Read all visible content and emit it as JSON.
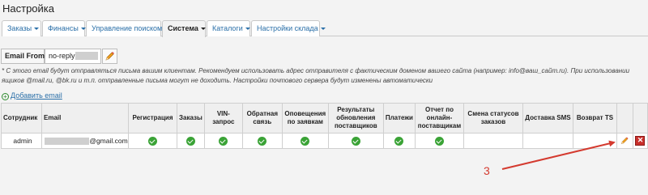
{
  "page": {
    "title": "Настройка"
  },
  "tabs": [
    {
      "label": "Заказы",
      "active": false
    },
    {
      "label": "Финансы",
      "active": false
    },
    {
      "label": "Управление поиском",
      "active": false
    },
    {
      "label": "Система",
      "active": true
    },
    {
      "label": "Каталоги",
      "active": false
    },
    {
      "label": "Настройки склада",
      "active": false
    }
  ],
  "email_from": {
    "label": "Email From*",
    "value": "no-reply@"
  },
  "note": "* С этого email будут отправляться письма вашим клиентам. Рекомендуем использовать адрес отправителя с фактическим доменом вашего сайта (например: info@ваш_сайт.ru). При использовании ящиков @mail.ru, @bk.ru и т.п. отправленные письма могут не доходить. Настройки почтового сервера будут изменены автоматически",
  "add_email": {
    "label": "Добавить email"
  },
  "table": {
    "headers": [
      "Сотрудник",
      "Email",
      "Регистрация",
      "Заказы",
      "VIN-запрос",
      "Обратная связь",
      "Оповещения по заявкам",
      "Результаты обновления поставщиков",
      "Платежи",
      "Отчет по онлайн-поставщикам",
      "Смена статусов заказов",
      "Доставка SMS",
      "Возврат TS",
      "",
      ""
    ],
    "rows": [
      {
        "employee": "admin",
        "email_suffix": "@gmail.com",
        "checks": [
          true,
          true,
          true,
          true,
          true,
          true,
          true,
          true,
          false,
          false,
          false
        ]
      }
    ]
  },
  "annotation": {
    "number": "3",
    "color": "#d43a2f"
  },
  "colors": {
    "link": "#2a6fa8",
    "check": "#3aa336",
    "delete": "#c9302c"
  }
}
